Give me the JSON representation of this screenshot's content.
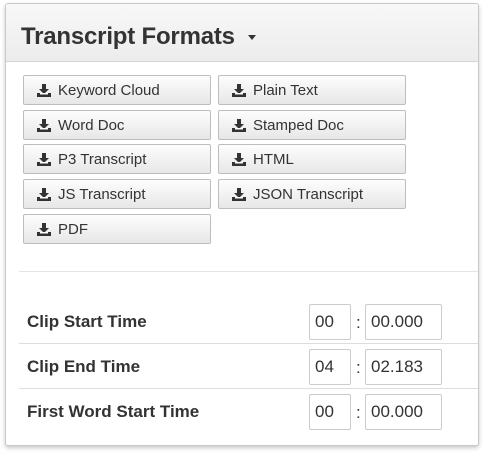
{
  "panel": {
    "title": "Transcript Formats",
    "caret_icon": "caret-down-icon"
  },
  "formats": {
    "icon": "download-icon",
    "buttons": [
      {
        "label": "Keyword Cloud"
      },
      {
        "label": "Plain Text"
      },
      {
        "label": "Word Doc"
      },
      {
        "label": "Stamped Doc"
      },
      {
        "label": "P3 Transcript"
      },
      {
        "label": "HTML"
      },
      {
        "label": "JS Transcript"
      },
      {
        "label": "JSON Transcript"
      },
      {
        "label": "PDF"
      }
    ]
  },
  "times": {
    "separator": ":",
    "rows": [
      {
        "label": "Clip Start Time",
        "minutes": "00",
        "seconds": "00.000"
      },
      {
        "label": "Clip End Time",
        "minutes": "04",
        "seconds": "02.183"
      },
      {
        "label": "First Word Start Time",
        "minutes": "00",
        "seconds": "00.000"
      }
    ]
  },
  "colors": {
    "text": "#333333",
    "header_bg": "#eeeeee",
    "button_border": "#bdbdbd"
  }
}
